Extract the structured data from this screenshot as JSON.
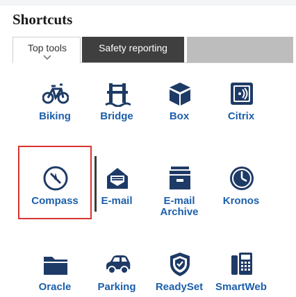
{
  "header": {
    "title": "Shortcuts"
  },
  "tabs": [
    {
      "label": "Top tools",
      "active": true
    },
    {
      "label": "Safety reporting",
      "active": false
    }
  ],
  "shortcuts": [
    {
      "label": "Biking",
      "icon": "bicycle-icon"
    },
    {
      "label": "Bridge",
      "icon": "bridge-icon"
    },
    {
      "label": "Box",
      "icon": "box-icon"
    },
    {
      "label": "Citrix",
      "icon": "citrix-icon"
    },
    {
      "label": "Compass",
      "icon": "compass-icon"
    },
    {
      "label": "E-mail",
      "icon": "mail-icon"
    },
    {
      "label": "E-mail\nArchive",
      "icon": "archive-icon"
    },
    {
      "label": "Kronos",
      "icon": "clock-icon"
    },
    {
      "label": "Oracle",
      "icon": "folder-icon"
    },
    {
      "label": "Parking",
      "icon": "car-icon"
    },
    {
      "label": "ReadySet",
      "icon": "shield-icon"
    },
    {
      "label": "SmartWeb",
      "icon": "phone-icon"
    }
  ],
  "colors": {
    "link": "#1c5fab",
    "icon": "#1e3a66",
    "highlight": "#d8332f",
    "tab_inactive": "#3f3f3f"
  }
}
